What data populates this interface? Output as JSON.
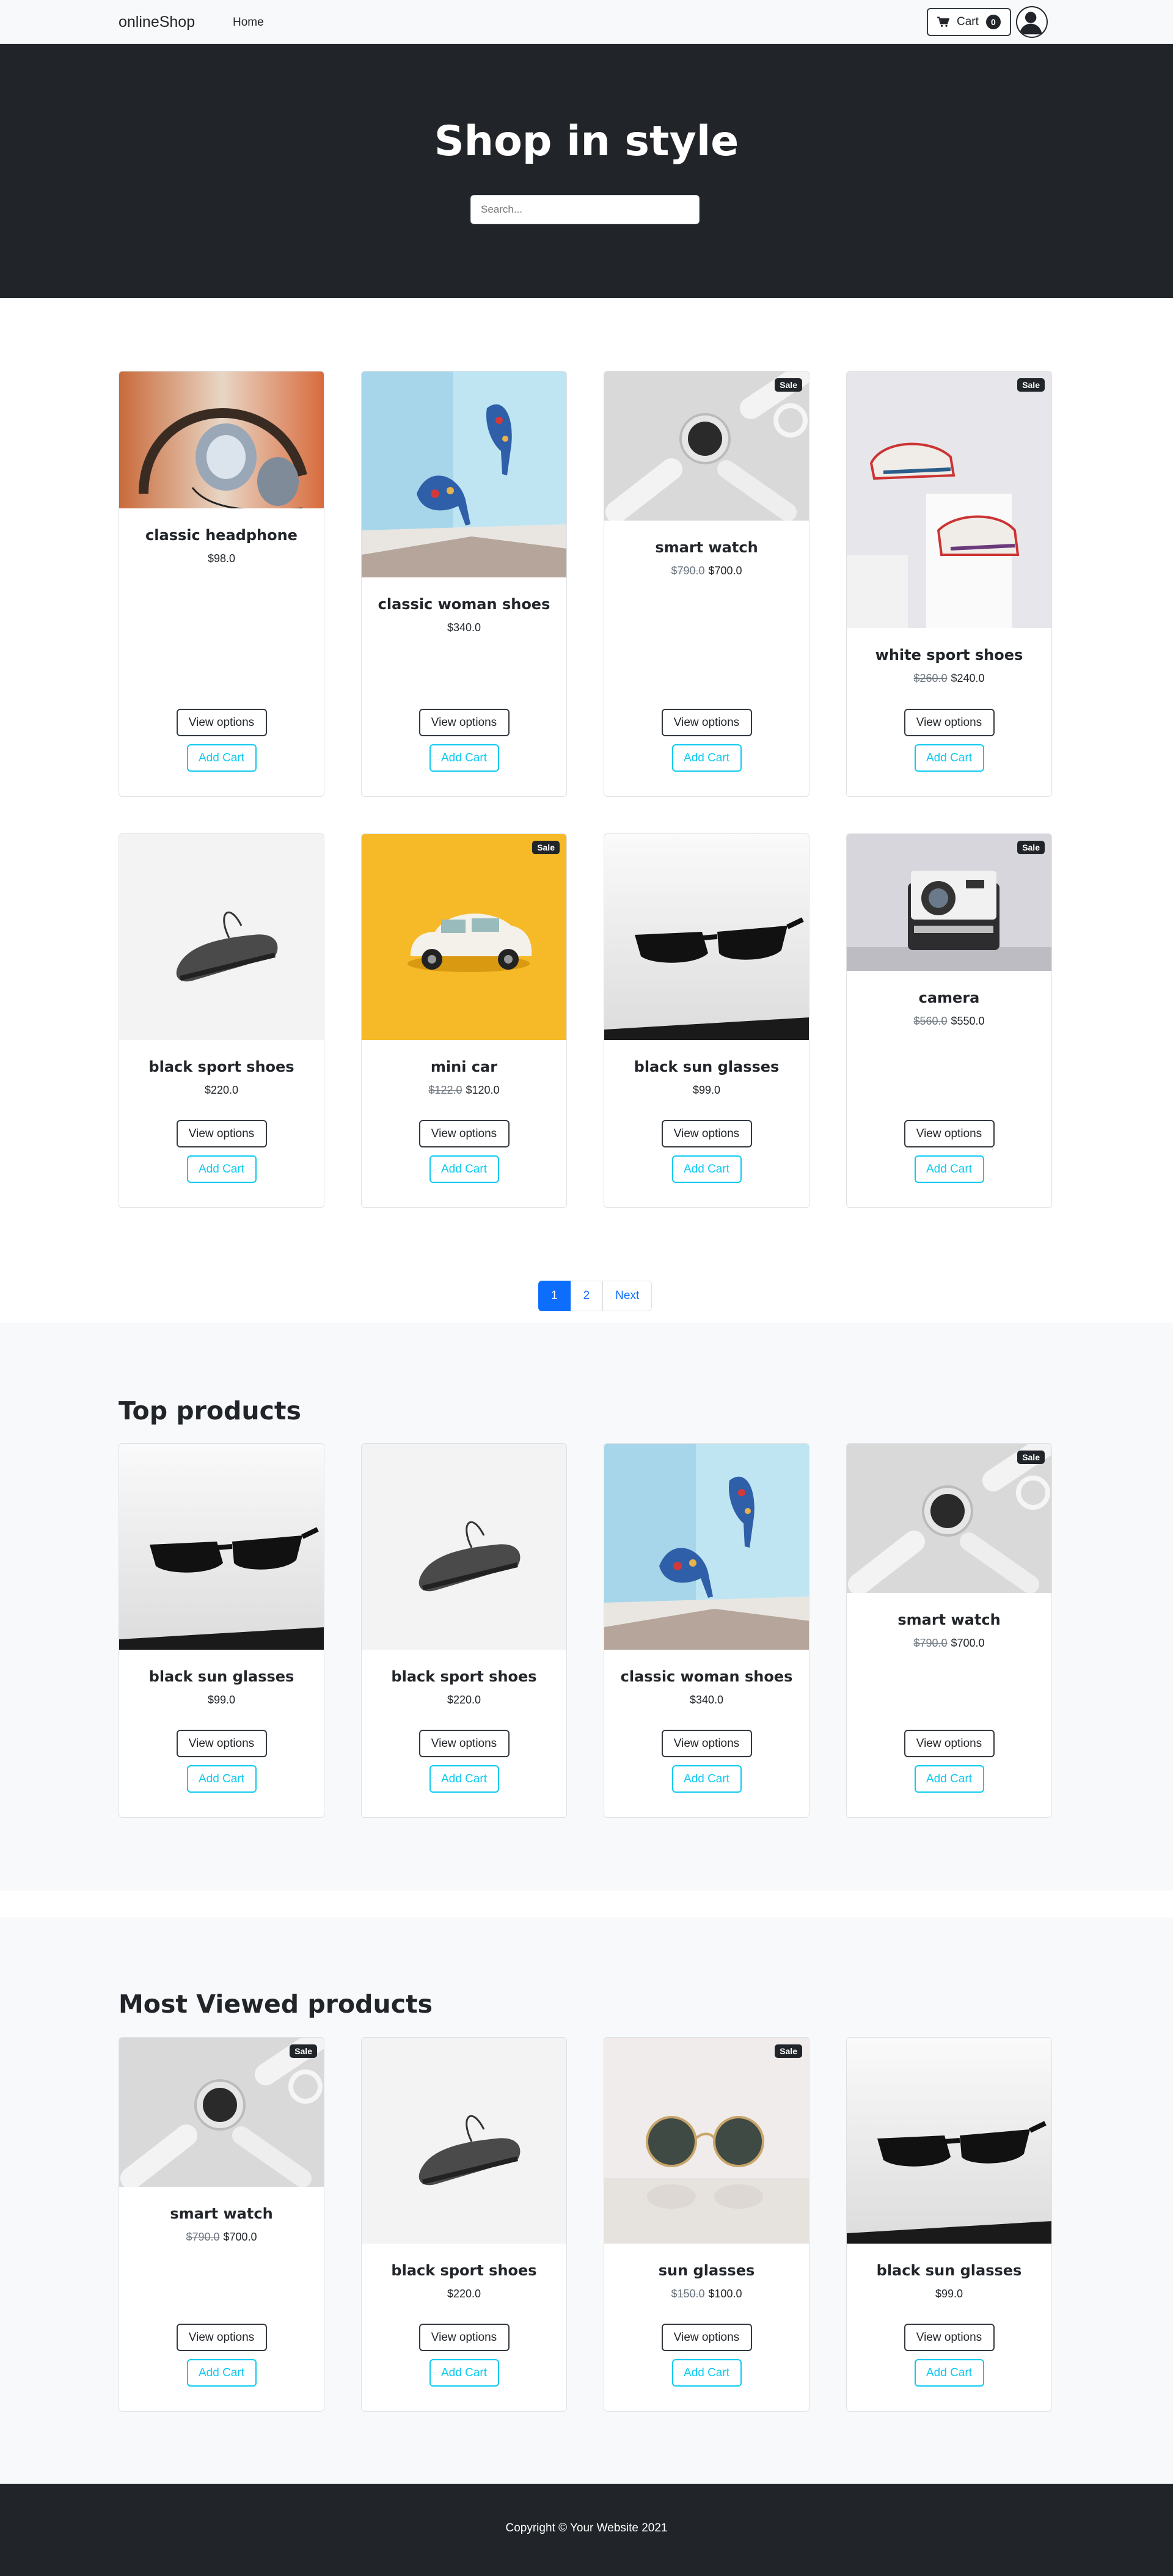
{
  "nav": {
    "brand": "onlineShop",
    "home": "Home",
    "cart_label": "Cart",
    "cart_count": "0"
  },
  "hero": {
    "title": "Shop in style",
    "search_placeholder": "Search..."
  },
  "buttons": {
    "view": "View options",
    "add": "Add Cart"
  },
  "sale_label": "Sale",
  "products": [
    {
      "name": "classic headphone",
      "price": "$98.0",
      "old": "",
      "sale": false,
      "img": "headphone"
    },
    {
      "name": "classic woman shoes",
      "price": "$340.0",
      "old": "",
      "sale": false,
      "img": "heels"
    },
    {
      "name": "smart watch",
      "price": "$700.0",
      "old": "$790.0",
      "sale": true,
      "img": "watch"
    },
    {
      "name": "white sport shoes",
      "price": "$240.0",
      "old": "$260.0",
      "sale": true,
      "img": "sneakers"
    },
    {
      "name": "black sport shoes",
      "price": "$220.0",
      "old": "",
      "sale": false,
      "img": "blackshoe"
    },
    {
      "name": "mini car",
      "price": "$120.0",
      "old": "$122.0",
      "sale": true,
      "img": "car"
    },
    {
      "name": "black sun glasses",
      "price": "$99.0",
      "old": "",
      "sale": false,
      "img": "sunglasses"
    },
    {
      "name": "camera",
      "price": "$550.0",
      "old": "$560.0",
      "sale": true,
      "img": "camera"
    }
  ],
  "pagination": {
    "pages": [
      "1",
      "2"
    ],
    "next": "Next",
    "active": "1"
  },
  "top": {
    "title": "Top products",
    "products": [
      {
        "name": "black sun glasses",
        "price": "$99.0",
        "old": "",
        "sale": false,
        "img": "sunglasses"
      },
      {
        "name": "black sport shoes",
        "price": "$220.0",
        "old": "",
        "sale": false,
        "img": "blackshoe"
      },
      {
        "name": "classic woman shoes",
        "price": "$340.0",
        "old": "",
        "sale": false,
        "img": "heels"
      },
      {
        "name": "smart watch",
        "price": "$700.0",
        "old": "$790.0",
        "sale": true,
        "img": "watch"
      }
    ]
  },
  "most_viewed": {
    "title": "Most Viewed products",
    "products": [
      {
        "name": "smart watch",
        "price": "$700.0",
        "old": "$790.0",
        "sale": true,
        "img": "watch"
      },
      {
        "name": "black sport shoes",
        "price": "$220.0",
        "old": "",
        "sale": false,
        "img": "blackshoe"
      },
      {
        "name": "sun glasses",
        "price": "$100.0",
        "old": "$150.0",
        "sale": true,
        "img": "roundglasses"
      },
      {
        "name": "black sun glasses",
        "price": "$99.0",
        "old": "",
        "sale": false,
        "img": "sunglasses"
      }
    ]
  },
  "footer": {
    "copyright": "Copyright © Your Website 2021"
  },
  "colors": {
    "dark": "#212529",
    "primary": "#0d6efd",
    "info": "#0dcaf0",
    "light": "#f8f9fa"
  }
}
